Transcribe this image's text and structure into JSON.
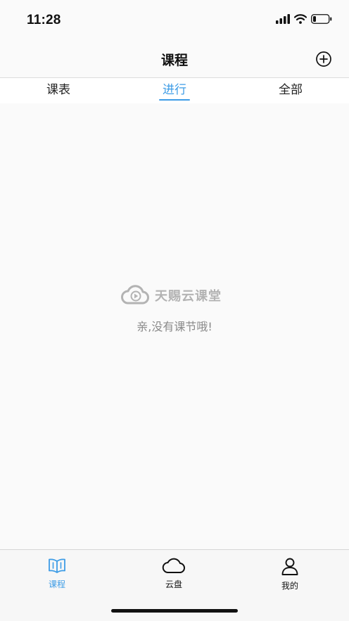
{
  "status_bar": {
    "time": "11:28"
  },
  "navbar": {
    "title": "课程"
  },
  "tabs": [
    {
      "label": "课表",
      "active": false
    },
    {
      "label": "进行",
      "active": true
    },
    {
      "label": "全部",
      "active": false
    }
  ],
  "empty_state": {
    "brand": "天赐云课堂",
    "message": "亲,没有课节哦!"
  },
  "tabbar": {
    "items": [
      {
        "label": "课程",
        "icon": "book-icon",
        "active": true
      },
      {
        "label": "云盘",
        "icon": "cloud-icon",
        "active": false
      },
      {
        "label": "我的",
        "icon": "person-icon",
        "active": false
      }
    ]
  },
  "colors": {
    "accent": "#3d9ce6",
    "muted": "#8a8a8a",
    "background": "#fafafa"
  }
}
